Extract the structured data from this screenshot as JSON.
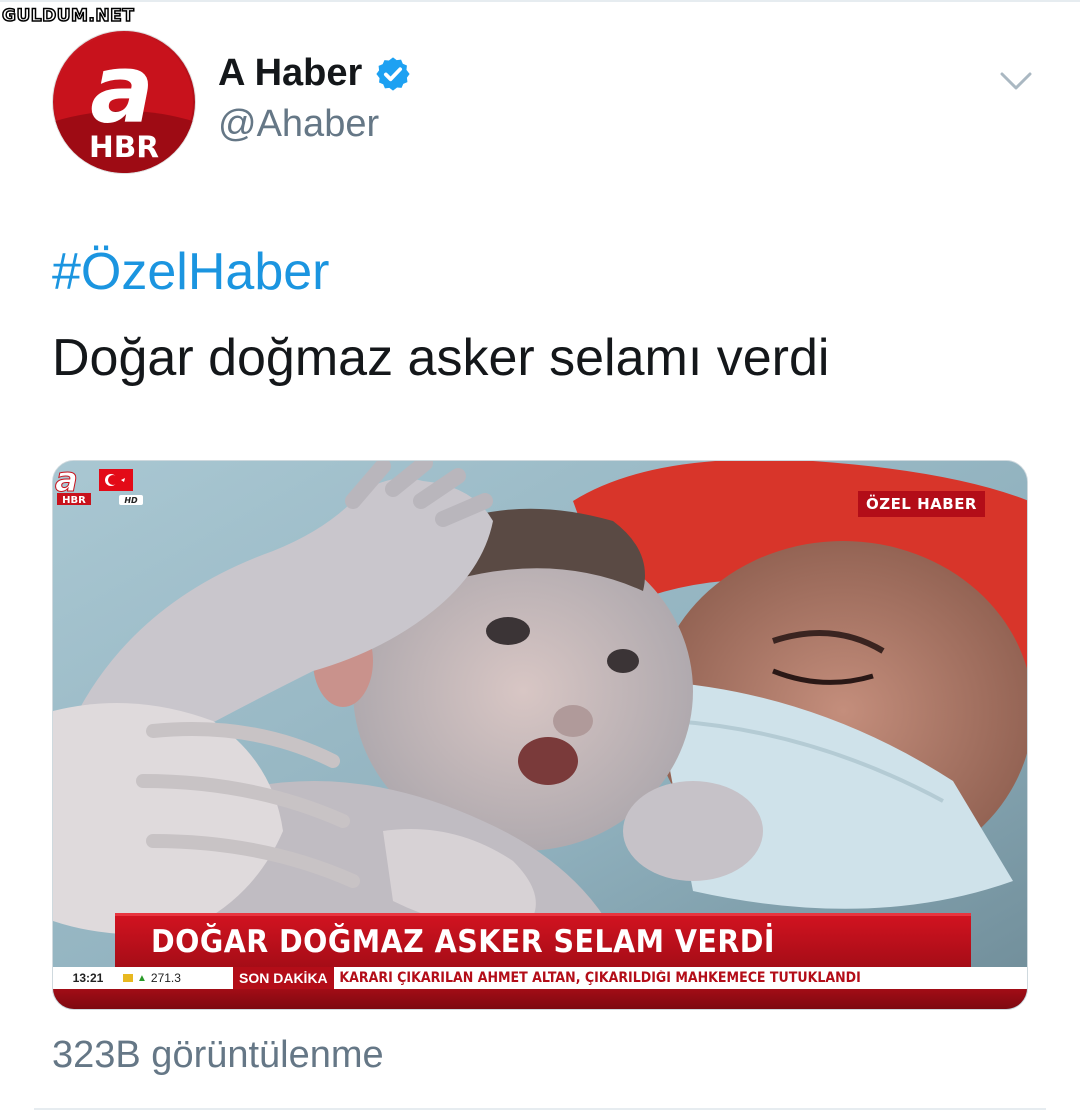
{
  "watermark": "GULDUM.NET",
  "tweet": {
    "author": {
      "display_name": "A Haber",
      "handle": "@Ahaber",
      "verified": true,
      "avatar_logo_text": "a",
      "avatar_logo_sub": "HBR"
    },
    "hashtag": "#ÖzelHaber",
    "text": "Doğar doğmaz asker selamı verdi",
    "media": {
      "channel_logo": "a HBR HD",
      "badge": "ÖZEL HABER",
      "headline": "DOĞAR DOĞMAZ ASKER SELAM VERDİ",
      "ticker": {
        "time": "13:21",
        "index": "271.3",
        "label": "SON DAKİKA",
        "text": "KARARI ÇIKARILAN AHMET ALTAN, ÇIKARILDIĞI MAHKEMECE TUTUKLANDI"
      }
    },
    "views": "323B görüntülenme"
  },
  "colors": {
    "link": "#1b95e0",
    "verified": "#1da1f2",
    "muted": "#657786",
    "brand_red": "#b30d18"
  },
  "icons": {
    "verified": "verified-badge-icon",
    "menu": "chevron-down-icon"
  }
}
